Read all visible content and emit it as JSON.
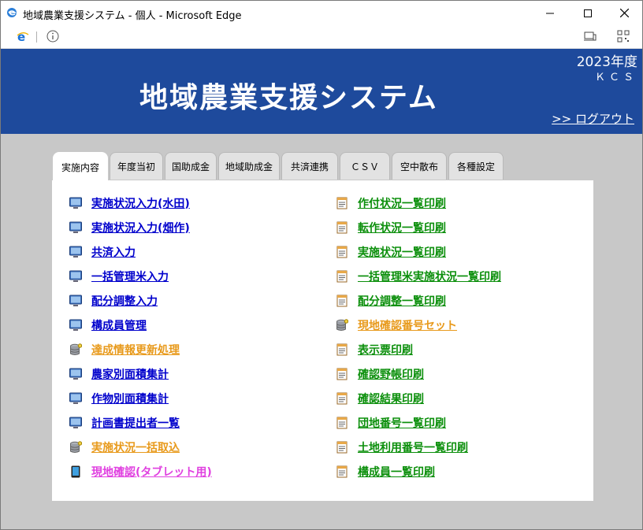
{
  "window": {
    "title": "地域農業支援システム - 個人 - Microsoft Edge"
  },
  "header": {
    "system_title": "地域農業支援システム",
    "year": "2023年度",
    "org": "ＫＣＳ",
    "logout": ">> ログアウト"
  },
  "tabs": [
    {
      "label": "実施内容",
      "active": true
    },
    {
      "label": "年度当初",
      "active": false
    },
    {
      "label": "国助成金",
      "active": false
    },
    {
      "label": "地域助成金",
      "active": false
    },
    {
      "label": "共済連携",
      "active": false
    },
    {
      "label": "ＣＳＶ",
      "active": false
    },
    {
      "label": "空中散布",
      "active": false
    },
    {
      "label": "各種設定",
      "active": false
    }
  ],
  "left_menu": [
    {
      "label": "実施状況入力(水田)",
      "icon": "monitor-icon",
      "color": "#0000cc"
    },
    {
      "label": "実施状況入力(畑作)",
      "icon": "monitor-icon",
      "color": "#0000cc"
    },
    {
      "label": "共済入力",
      "icon": "monitor-icon",
      "color": "#0000cc"
    },
    {
      "label": "一括管理米入力",
      "icon": "monitor-icon",
      "color": "#0000cc"
    },
    {
      "label": "配分調整入力",
      "icon": "monitor-icon",
      "color": "#0000cc"
    },
    {
      "label": "構成員管理",
      "icon": "monitor-icon",
      "color": "#0000cc"
    },
    {
      "label": "達成情報更新処理",
      "icon": "database-icon",
      "color": "#e89a1c"
    },
    {
      "label": "農家別面積集計",
      "icon": "monitor-icon",
      "color": "#0000cc"
    },
    {
      "label": "作物別面積集計",
      "icon": "monitor-icon",
      "color": "#0000cc"
    },
    {
      "label": "計画書提出者一覧",
      "icon": "monitor-icon",
      "color": "#0000cc"
    },
    {
      "label": "実施状況一括取込",
      "icon": "database-icon",
      "color": "#e89a1c"
    },
    {
      "label": "現地確認(タブレット用)",
      "icon": "tablet-icon",
      "color": "#e040e0"
    }
  ],
  "right_menu": [
    {
      "label": "作付状況一覧印刷",
      "icon": "report-icon",
      "color": "#0b8f0b"
    },
    {
      "label": "転作状況一覧印刷",
      "icon": "report-icon",
      "color": "#0b8f0b"
    },
    {
      "label": "実施状況一覧印刷",
      "icon": "report-icon",
      "color": "#0b8f0b"
    },
    {
      "label": "一括管理米実施状況一覧印刷",
      "icon": "report-icon",
      "color": "#0b8f0b"
    },
    {
      "label": "配分調整一覧印刷",
      "icon": "report-icon",
      "color": "#0b8f0b"
    },
    {
      "label": "現地確認番号セット",
      "icon": "database-icon",
      "color": "#e89a1c"
    },
    {
      "label": "表示票印刷",
      "icon": "report-icon",
      "color": "#0b8f0b"
    },
    {
      "label": "確認野帳印刷",
      "icon": "report-icon",
      "color": "#0b8f0b"
    },
    {
      "label": "確認結果印刷",
      "icon": "report-icon",
      "color": "#0b8f0b"
    },
    {
      "label": "団地番号一覧印刷",
      "icon": "report-icon",
      "color": "#0b8f0b"
    },
    {
      "label": "土地利用番号一覧印刷",
      "icon": "report-icon",
      "color": "#0b8f0b"
    },
    {
      "label": "構成員一覧印刷",
      "icon": "report-icon",
      "color": "#0b8f0b"
    }
  ]
}
